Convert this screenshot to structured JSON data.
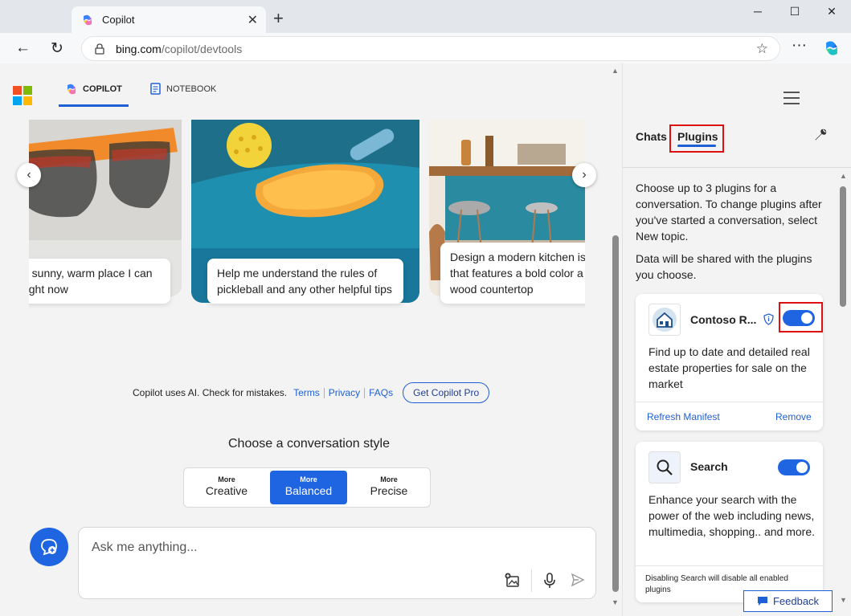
{
  "browser": {
    "tab_title": "Copilot",
    "url_domain": "bing.com",
    "url_path": "/copilot/devtools"
  },
  "topnav": {
    "copilot_label": "COPILOT",
    "notebook_label": "NOTEBOOK"
  },
  "carousel": {
    "cards": [
      {
        "caption": "a sunny, warm place I can right now"
      },
      {
        "caption": "Help me understand the rules of pickleball and any other helpful tips"
      },
      {
        "caption": "Design a modern kitchen is that features a bold color a wood countertop"
      }
    ]
  },
  "disclaimer": {
    "text": "Copilot uses AI. Check for mistakes.",
    "terms": "Terms",
    "privacy": "Privacy",
    "faqs": "FAQs",
    "get_pro": "Get Copilot Pro"
  },
  "conversation_style": {
    "title": "Choose a conversation style",
    "options": [
      {
        "small": "More",
        "label": "Creative",
        "active": false
      },
      {
        "small": "More",
        "label": "Balanced",
        "active": true
      },
      {
        "small": "More",
        "label": "Precise",
        "active": false
      }
    ]
  },
  "ask": {
    "placeholder": "Ask me anything..."
  },
  "sidebar": {
    "tabs": {
      "chats": "Chats",
      "plugins": "Plugins"
    },
    "intro": "Choose up to 3 plugins for a conversation. To change plugins after you've started a conversation, select New topic.",
    "data_note": "Data will be shared with the plugins you choose.",
    "plugins": [
      {
        "name": "Contoso R...",
        "enabled": true,
        "description": "Find up to date and detailed real estate properties for sale on the market",
        "refresh": "Refresh Manifest",
        "remove": "Remove"
      },
      {
        "name": "Search",
        "enabled": true,
        "description": "Enhance your search with the power of the web including news, multimedia, shopping.. and more.",
        "note": "Disabling Search will disable all enabled plugins"
      }
    ],
    "feedback": "Feedback"
  },
  "colors": {
    "accent": "#1f64e0",
    "highlight_box": "#dd1111"
  }
}
